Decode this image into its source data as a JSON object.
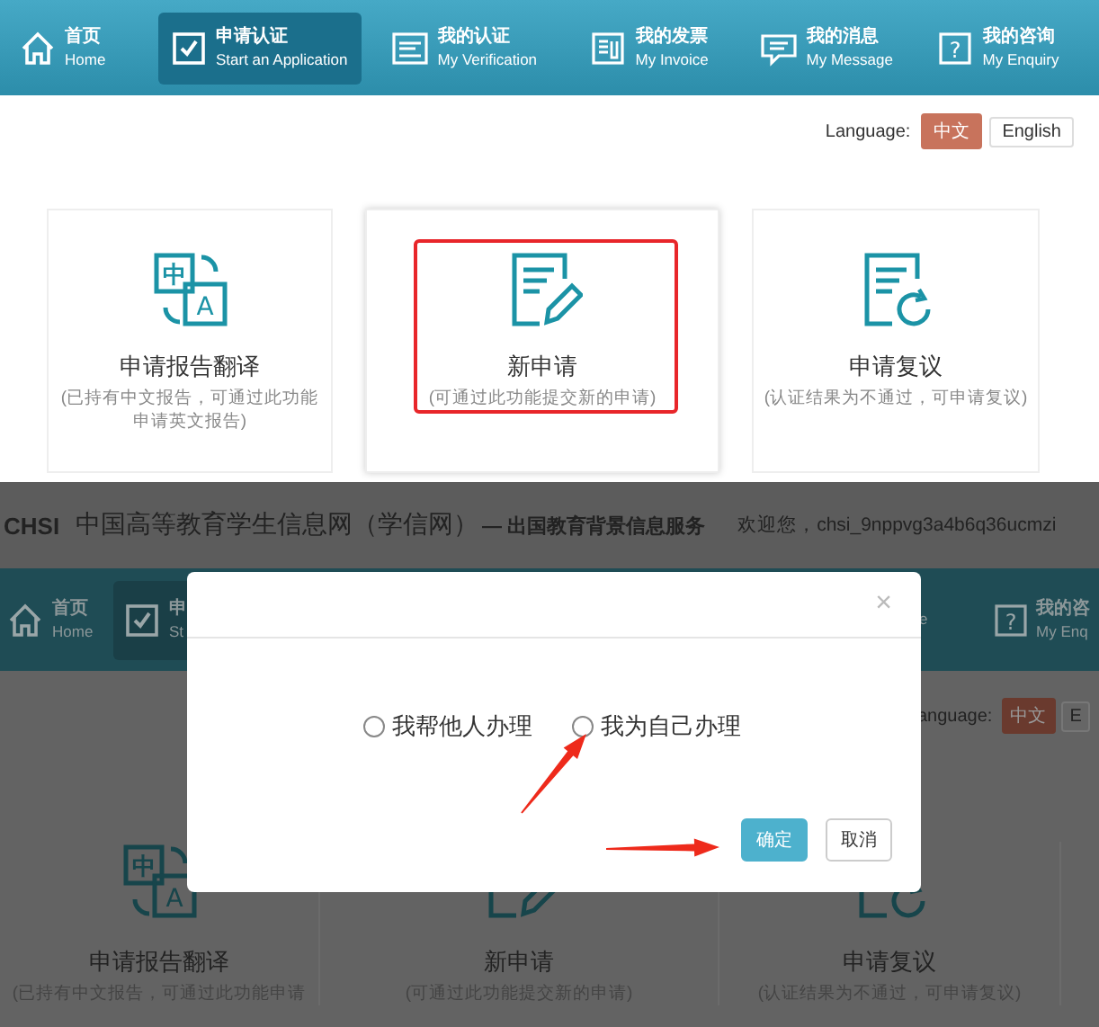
{
  "top_screen": {
    "nav": [
      {
        "title": "首页",
        "subtitle": "Home",
        "selected": false
      },
      {
        "title": "申请认证",
        "subtitle": "Start an Application",
        "selected": true
      },
      {
        "title": "我的认证",
        "subtitle": "My Verification",
        "selected": false
      },
      {
        "title": "我的发票",
        "subtitle": "My Invoice",
        "selected": false
      },
      {
        "title": "我的消息",
        "subtitle": "My Message",
        "selected": false
      },
      {
        "title": "我的咨询",
        "subtitle": "My Enquiry",
        "selected": false,
        "glyph": "?"
      }
    ],
    "language": {
      "label": "Language:",
      "options": [
        {
          "label": "中文",
          "selected": true
        },
        {
          "label": "English",
          "selected": false
        }
      ]
    },
    "cards": [
      {
        "title": "申请报告翻译",
        "description": "(已持有中文报告，可通过此功能申请英文报告)",
        "glyphs": [
          "中",
          "A"
        ],
        "highlighted": false
      },
      {
        "title": "新申请",
        "description": "(可通过此功能提交新的申请)",
        "highlighted": true
      },
      {
        "title": "申请复议",
        "description": "(认证结果为不通过，可申请复议)",
        "highlighted": false
      }
    ]
  },
  "bottom_screen": {
    "header": {
      "logo": "CHSI",
      "title": "中国高等教育学生信息网（学信网）",
      "subtitle": "— 出国教育背景信息服务",
      "welcome": "欢迎您，chsi_9nppvg3a4b6q36ucmzi"
    },
    "nav": [
      {
        "title": "首页",
        "subtitle": "Home",
        "selected": false
      },
      {
        "title": "申",
        "subtitle": "St",
        "selected": true
      },
      {
        "subtitle": "e",
        "selected": false
      },
      {
        "title": "我的咨",
        "subtitle": "My Enq",
        "selected": false,
        "glyph": "?"
      }
    ],
    "language": {
      "label": "anguage:",
      "options": [
        {
          "label": "中文",
          "selected": true
        },
        {
          "label": "E",
          "selected": false
        }
      ]
    },
    "cards": [
      {
        "title": "申请报告翻译",
        "description": "(已持有中文报告，可通过此功能申请",
        "glyphs": [
          "中",
          "A"
        ]
      },
      {
        "title": "新申请",
        "description": "(可通过此功能提交新的申请)"
      },
      {
        "title": "申请复议",
        "description": "(认证结果为不通过，可申请复议)"
      }
    ],
    "dialog": {
      "close": "×",
      "options": [
        {
          "label": "我帮他人办理",
          "selected": false
        },
        {
          "label": "我为自己办理",
          "selected": false
        }
      ],
      "buttons": [
        {
          "label": "确定",
          "kind": "primary"
        },
        {
          "label": "取消",
          "kind": "default"
        }
      ]
    }
  }
}
